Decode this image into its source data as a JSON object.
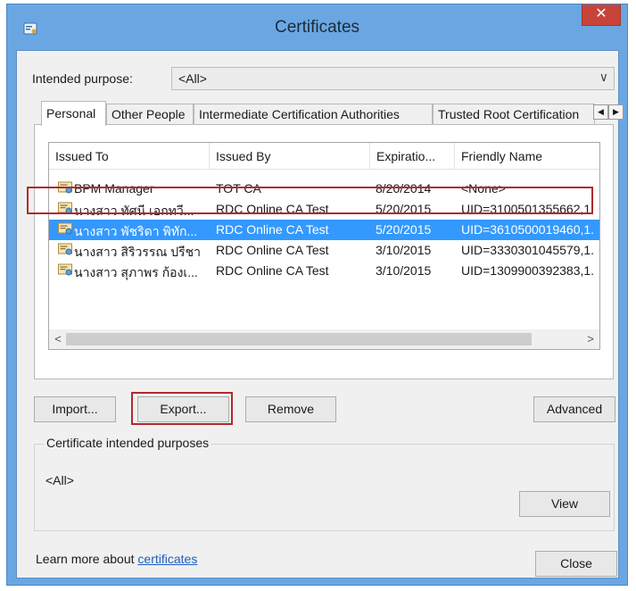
{
  "window": {
    "title": "Certificates",
    "close_glyph": "✕",
    "title_icon": "certificate-manager-icon"
  },
  "purpose": {
    "label": "Intended purpose:",
    "value": "<All>"
  },
  "tabs": [
    {
      "label": "Personal"
    },
    {
      "label": "Other People"
    },
    {
      "label": "Intermediate Certification Authorities"
    },
    {
      "label": "Trusted Root Certification"
    }
  ],
  "table": {
    "columns": [
      "Issued To",
      "Issued By",
      "Expiratio...",
      "Friendly Name"
    ],
    "rows": [
      {
        "issued_to": "BPM Manager",
        "issued_by": "TOT CA",
        "expiration": "8/20/2014",
        "friendly_name": "<None>"
      },
      {
        "issued_to": "นางสาว ทัศนี เอกทวี...",
        "issued_by": "RDC Online CA Test",
        "expiration": "5/20/2015",
        "friendly_name": "UID=3100501355662,1."
      },
      {
        "issued_to": "นางสาว พัชริดา พิทัก...",
        "issued_by": "RDC Online CA Test",
        "expiration": "5/20/2015",
        "friendly_name": "UID=3610500019460,1."
      },
      {
        "issued_to": "นางสาว สิริวรรณ ปรีชา",
        "issued_by": "RDC Online CA Test",
        "expiration": "3/10/2015",
        "friendly_name": "UID=3330301045579,1."
      },
      {
        "issued_to": "นางสาว สุภาพร ก้องเ...",
        "issued_by": "RDC Online CA Test",
        "expiration": "3/10/2015",
        "friendly_name": "UID=1309900392383,1."
      }
    ],
    "selected_row": 2
  },
  "buttons": {
    "import": "Import...",
    "export": "Export...",
    "remove": "Remove",
    "advanced": "Advanced",
    "view": "View",
    "close": "Close"
  },
  "purposes_group": {
    "label": "Certificate intended purposes",
    "value": "<All>"
  },
  "learn_more": {
    "prefix": "Learn more about ",
    "link": "certificates"
  },
  "colors": {
    "titlebar": "#6aa7e2",
    "close_button": "#c8443a",
    "selection": "#3399ff",
    "highlight_outline": "#b02a2f"
  }
}
